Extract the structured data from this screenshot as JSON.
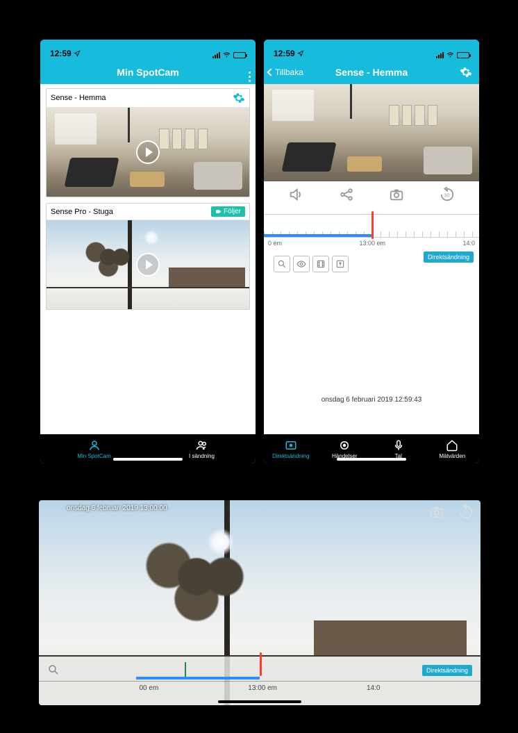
{
  "status": {
    "time": "12:59"
  },
  "left": {
    "title": "Min SpotCam",
    "cards": [
      {
        "title": "Sense - Hemma"
      },
      {
        "title": "Sense Pro - Stuga",
        "badge": "Följer"
      }
    ],
    "tabs": [
      {
        "label": "Min SpotCam",
        "active": true
      },
      {
        "label": "I sändning",
        "active": false
      }
    ]
  },
  "right": {
    "back": "Tillbaka",
    "title": "Sense - Hemma",
    "timeline": {
      "t1": "0 em",
      "t2": "13:00 em",
      "t3": "14:0",
      "live": "Direktsändning"
    },
    "datetime": "onsdag 6 februari 2019 12:59:43",
    "tabs": [
      {
        "label": "Direktsändning",
        "active": true
      },
      {
        "label": "Händelser",
        "active": false
      },
      {
        "label": "Tal",
        "active": false
      },
      {
        "label": "Mätvärden",
        "active": false
      }
    ]
  },
  "landscape": {
    "ts": "onsdag 6 februari 2019 13:00:00",
    "t1": "00 em",
    "t2": "13:00 em",
    "t3": "14:0",
    "live": "Direktsändning"
  }
}
